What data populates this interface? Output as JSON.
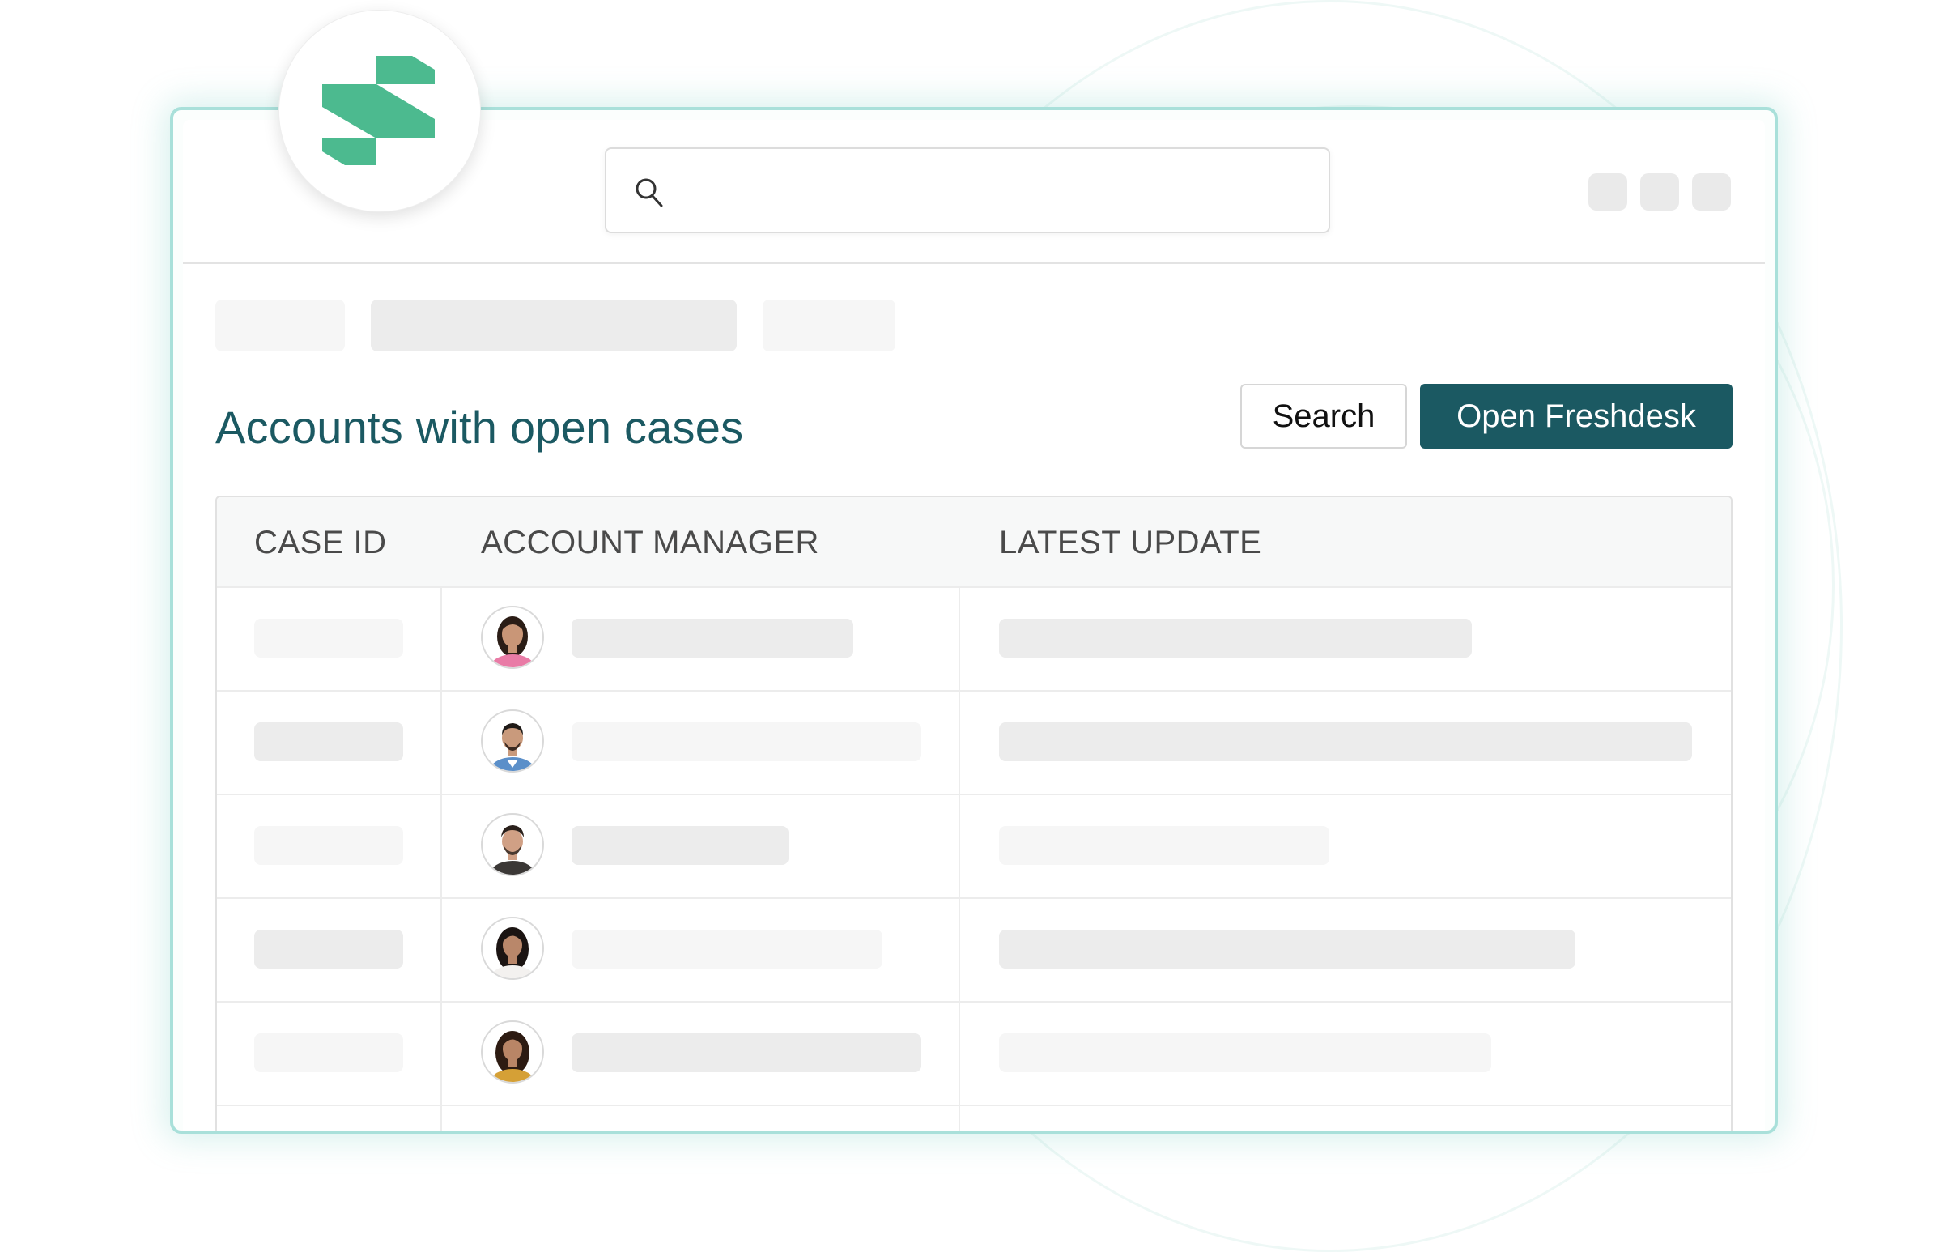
{
  "app": {
    "brand_color": "#4cba8f",
    "accent_color": "#1b5962",
    "logo_icon": "s-logo-icon"
  },
  "topbar": {
    "search_icon": "search-icon",
    "search_placeholder": "",
    "window_controls": 3
  },
  "main": {
    "title": "Accounts with open cases",
    "buttons": {
      "search": "Search",
      "open_freshdesk": "Open Freshdesk"
    }
  },
  "table": {
    "headers": [
      "CASE ID",
      "ACCOUNT MANAGER",
      "LATEST UPDATE"
    ],
    "rows": [
      {
        "avatar": "avatar-woman-1",
        "skin": "#c99677",
        "hair": "#2b1d16",
        "shirt": "#e97ba6"
      },
      {
        "avatar": "avatar-man-1",
        "skin": "#c99a7c",
        "hair": "#1f1a17",
        "shirt": "#5b8fc9"
      },
      {
        "avatar": "avatar-man-2",
        "skin": "#d0a085",
        "hair": "#2a201b",
        "shirt": "#3b3836"
      },
      {
        "avatar": "avatar-woman-2",
        "skin": "#b9876a",
        "hair": "#1b1412",
        "shirt": "#f3f1ef"
      },
      {
        "avatar": "avatar-woman-3",
        "skin": "#b98566",
        "hair": "#2d1b12",
        "shirt": "#d5a036"
      }
    ]
  }
}
